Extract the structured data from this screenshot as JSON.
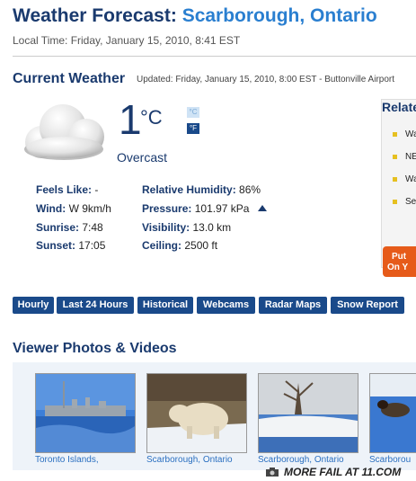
{
  "header": {
    "title_prefix": "Weather Forecast:",
    "title_city": "Scarborough, Ontario",
    "local_time": "Local Time: Friday, January 15, 2010, 8:41 EST"
  },
  "current": {
    "heading": "Current Weather",
    "updated": "Updated: Friday, January 15, 2010, 8:00 EST - Buttonville Airport",
    "temperature": "1",
    "temp_unit": "°C",
    "unit_c": "°C",
    "unit_f": "°F",
    "condition": "Overcast",
    "condition_icon": "cloud-icon",
    "stats": {
      "feels_like_label": "Feels Like:",
      "feels_like_value": "-",
      "wind_label": "Wind:",
      "wind_value": "W 9km/h",
      "sunrise_label": "Sunrise:",
      "sunrise_value": "7:48",
      "sunset_label": "Sunset:",
      "sunset_value": "17:05",
      "humidity_label": "Relative Humidity:",
      "humidity_value": "86%",
      "pressure_label": "Pressure:",
      "pressure_value": "101.97 kPa",
      "visibility_label": "Visibility:",
      "visibility_value": "13.0 km",
      "ceiling_label": "Ceiling:",
      "ceiling_value": "2500 ft"
    }
  },
  "related": {
    "title": "Relate",
    "items": [
      "Wa",
      "NE",
      "Wa",
      "Se"
    ]
  },
  "orange_button": {
    "line1": "Put",
    "line2": "On Y"
  },
  "nav": {
    "buttons": [
      "Hourly",
      "Last 24 Hours",
      "Historical",
      "Webcams",
      "Radar Maps",
      "Snow Report"
    ]
  },
  "photos": {
    "heading": "Viewer Photos & Videos",
    "captions": [
      "Toronto Islands,",
      "Scarborough, Ontario",
      "Scarborough, Ontario",
      "Scarborou"
    ]
  },
  "watermark": {
    "text": "MORE FAIL AT 11.COM"
  },
  "colors": {
    "heading_blue": "#1a3a6e",
    "link_blue": "#2a7fd0",
    "nav_button": "#1a4a8a",
    "orange": "#e65b1a"
  }
}
